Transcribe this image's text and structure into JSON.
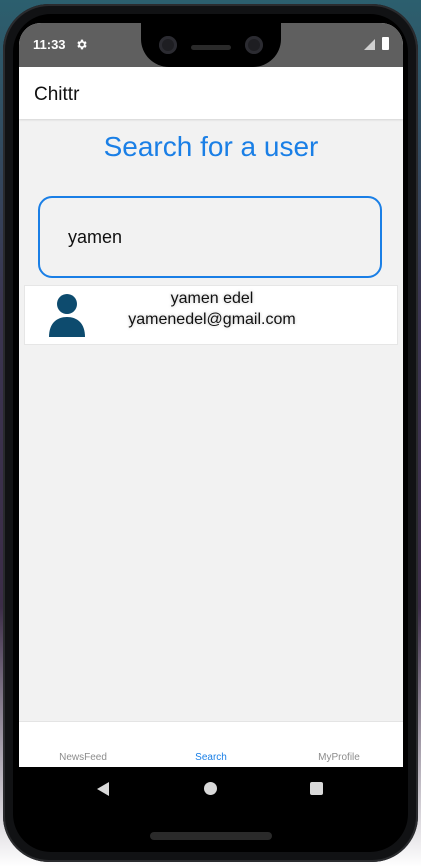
{
  "status_bar": {
    "time": "11:33",
    "icons": [
      "gear-icon",
      "signal-icon",
      "battery-icon"
    ]
  },
  "app_bar": {
    "title": "Chittr"
  },
  "search_page": {
    "heading": "Search for a user",
    "search_value": "yamen"
  },
  "results": [
    {
      "name": "yamen edel",
      "email": "yamenedel@gmail.com",
      "icon": "user-avatar-icon"
    }
  ],
  "tabs": [
    {
      "label": "NewsFeed",
      "active": false
    },
    {
      "label": "Search",
      "active": true
    },
    {
      "label": "MyProfile",
      "active": false
    }
  ],
  "nav_bar": {
    "icons": [
      "back-icon",
      "home-icon",
      "recents-icon"
    ]
  },
  "colors": {
    "accent": "#1a7fe6",
    "status_bar": "#5f5f5f",
    "screen_background": "#f2f2f2",
    "avatar": "#0d4b6e"
  }
}
